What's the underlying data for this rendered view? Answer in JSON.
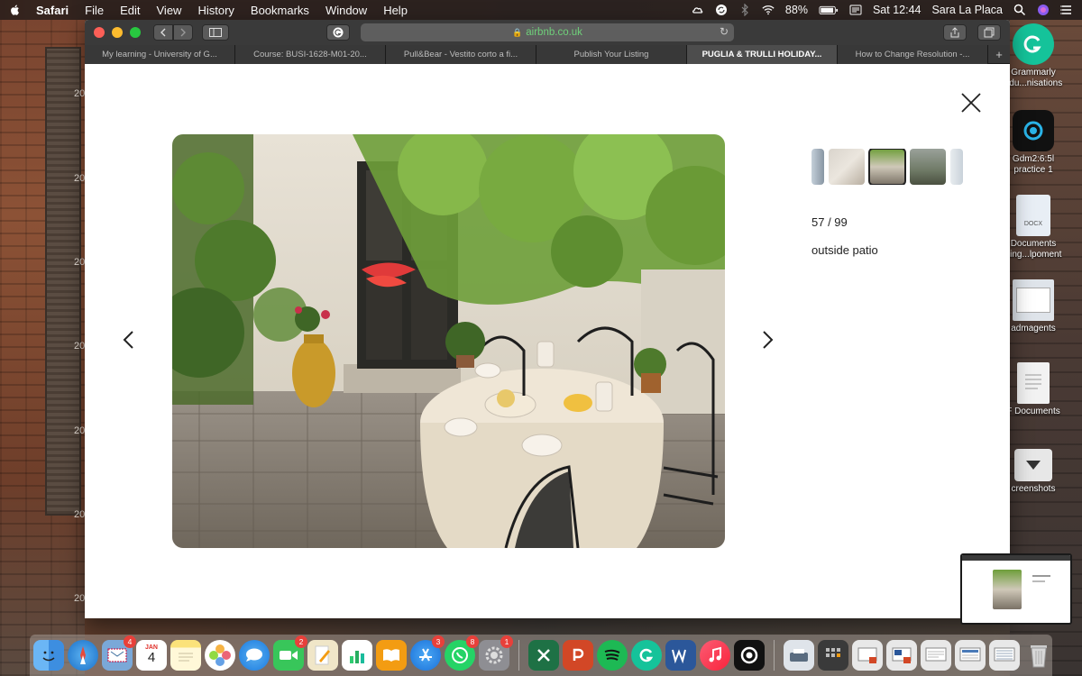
{
  "menubar": {
    "app_name": "Safari",
    "menus": [
      "File",
      "Edit",
      "View",
      "History",
      "Bookmarks",
      "Window",
      "Help"
    ],
    "status": {
      "battery": "88%",
      "clock": "Sat 12:44",
      "user": "Sara La Placa"
    }
  },
  "browser": {
    "address": "airbnb.co.uk",
    "tabs": [
      {
        "label": "My learning - University of G..."
      },
      {
        "label": "Course: BUSI-1628-M01-20..."
      },
      {
        "label": "Pull&Bear - Vestito corto a fi..."
      },
      {
        "label": "Publish Your Listing"
      },
      {
        "label": "PUGLIA & TRULLI HOLIDAY..."
      },
      {
        "label": "How to Change Resolution -..."
      }
    ],
    "active_tab_index": 4
  },
  "gallery": {
    "counter": "57 / 99",
    "caption": "outside patio"
  },
  "desktop": {
    "icons": [
      {
        "label": "Grammarly\nridu...nisations"
      },
      {
        "label": "Gdm2:6:5l\npractice 1"
      },
      {
        "label": "Documents\nning...lpoment"
      },
      {
        "label": "admagents"
      },
      {
        "label": "F Documents"
      },
      {
        "label": "creenshots"
      }
    ],
    "wall_years": [
      "20",
      "20",
      "20",
      "20",
      "20",
      "20",
      "20"
    ]
  },
  "dock": {
    "calendar_month": "JAN",
    "calendar_day": "4",
    "badges": {
      "mail": "4",
      "facetime": "2",
      "appstore": "3",
      "whatsapp": "8",
      "prefs": "1"
    }
  }
}
